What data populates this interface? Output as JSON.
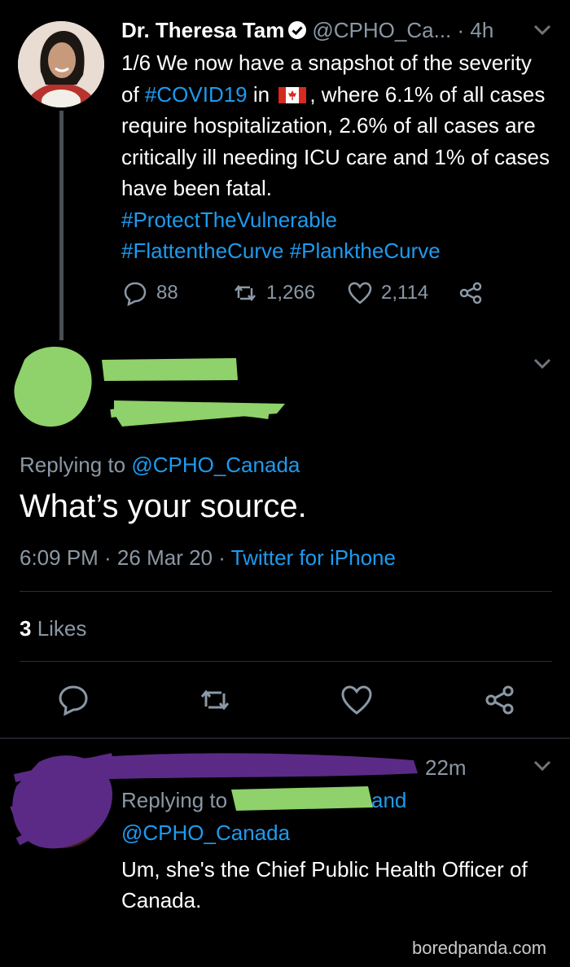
{
  "tweet1": {
    "author_name": "Dr. Theresa Tam",
    "handle": "@CPHO_Ca...",
    "time": "· 4h",
    "text_a": "1/6 We now have a snapshot of the severity of ",
    "hashtag_covid": "#COVID19",
    "text_b": " in ",
    "text_c": ", where 6.1% of all cases require hospitalization, 2.6% of all cases are critically ill needing ICU care and 1% of cases have been fatal.",
    "hashtag_1": "#ProtectTheVulnerable",
    "hashtag_2": "#FlattentheCurve",
    "hashtag_3": "#PlanktheCurve",
    "replies": "88",
    "retweets": "1,266",
    "likes": "2,114"
  },
  "tweet2": {
    "replying_prefix": "Replying to ",
    "replying_handle": "@CPHO_Canada",
    "text": "What’s your source.",
    "time": "6:09 PM · 26 Mar 20 · ",
    "client": "Twitter for iPhone",
    "likes_count": "3",
    "likes_label": " Likes"
  },
  "tweet3": {
    "time": "22m",
    "replying_prefix": "Replying to",
    "and": " and",
    "handle": "@CPHO_Canada",
    "text": "Um, she's the Chief Public Health Officer of Canada."
  },
  "watermark": "boredpanda.com",
  "colors": {
    "link": "#1d9bf0",
    "muted": "#8b98a5",
    "redaction_green": "#8fd16a",
    "redaction_purple": "#5b2a86"
  }
}
